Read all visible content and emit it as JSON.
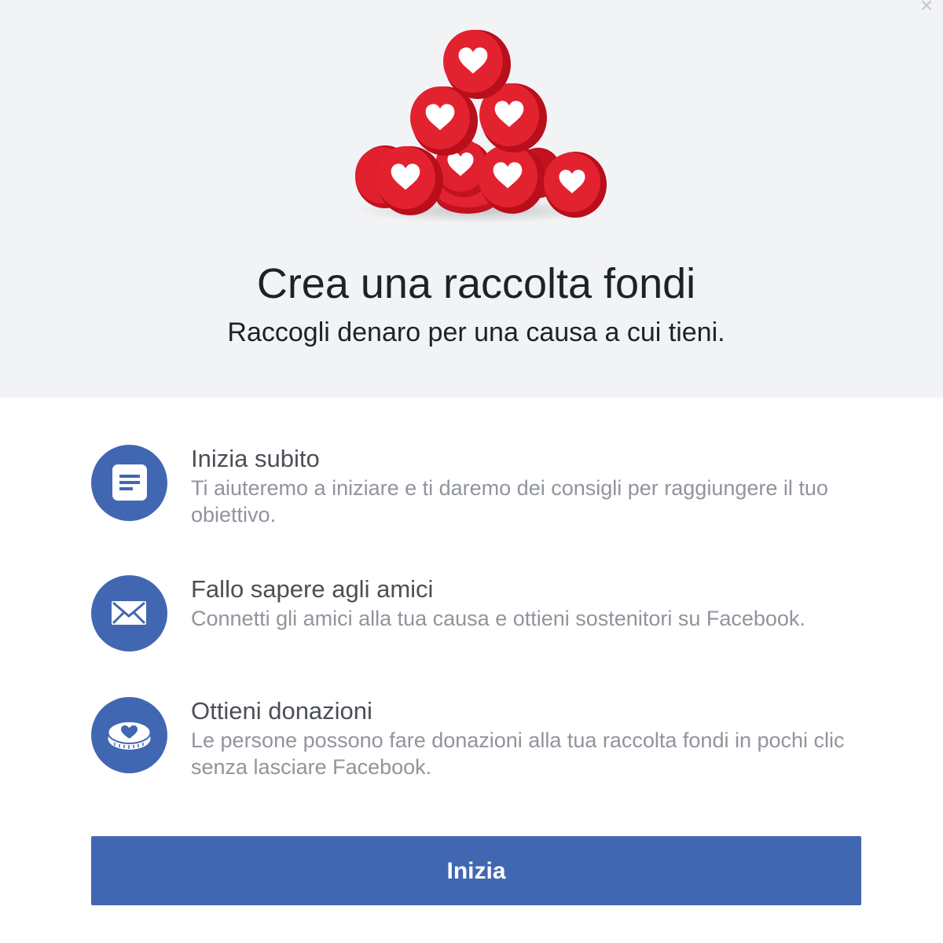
{
  "dialog": {
    "close_symbol": "×",
    "illustration": "red-heart-tokens-pile",
    "title": "Crea una raccolta fondi",
    "subtitle": "Raccogli denaro per una causa a cui tieni."
  },
  "features": [
    {
      "icon": "document-icon",
      "title": "Inizia subito",
      "description": "Ti aiuteremo a iniziare e ti daremo dei consigli per raggiungere il tuo obiettivo."
    },
    {
      "icon": "envelope-icon",
      "title": "Fallo sapere agli amici",
      "description": "Connetti gli amici alla tua causa e ottieni sostenitori su Facebook."
    },
    {
      "icon": "heart-coin-icon",
      "title": "Ottieni donazioni",
      "description": "Le persone possono fare donazioni alla tua raccolta fondi in pochi clic senza lasciare Facebook."
    }
  ],
  "cta": {
    "label": "Inizia"
  },
  "colors": {
    "accent": "#4267b2",
    "hero_background": "#f2f3f5",
    "heart_red": "#e0202e",
    "title_text": "#1d2129",
    "feature_title": "#4b4f56",
    "feature_desc": "#90949c"
  }
}
